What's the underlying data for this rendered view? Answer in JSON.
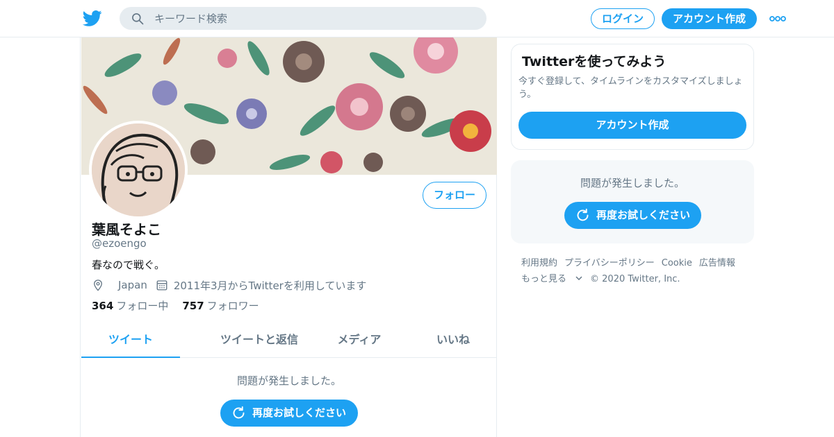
{
  "header": {
    "search_placeholder": "キーワード検索",
    "login_label": "ログイン",
    "signup_label": "アカウント作成",
    "icons": [
      "twitter-bird-icon",
      "search-icon",
      "more-icon"
    ]
  },
  "profile": {
    "follow_label": "フォロー",
    "display_name": "葉風そよこ",
    "handle": "@ezoengo",
    "bio": "春なので戦ぐ。",
    "location": "Japan",
    "joined": "2011年3月からTwitterを利用しています",
    "following_count": "364",
    "following_label": "フォロー中",
    "followers_count": "757",
    "followers_label": "フォロワー"
  },
  "tabs": [
    {
      "label": "ツイート",
      "active": true
    },
    {
      "label": "ツイートと返信",
      "active": false
    },
    {
      "label": "メディア",
      "active": false
    },
    {
      "label": "いいね",
      "active": false
    }
  ],
  "timeline": {
    "error_text": "問題が発生しました。",
    "retry_label": "再度お試しください"
  },
  "sidebar": {
    "promo_title": "Twitterを使ってみよう",
    "promo_text": "今すぐ登録して、タイムラインをカスタマイズしましょう。",
    "promo_button": "アカウント作成",
    "error_text": "問題が発生しました。",
    "retry_label": "再度お試しください"
  },
  "footer": {
    "links": [
      "利用規約",
      "プライバシーポリシー",
      "Cookie",
      "広告情報"
    ],
    "more_label": "もっと見る",
    "copyright": "© 2020 Twitter, Inc."
  },
  "colors": {
    "accent": "#1da1f2",
    "muted": "#657786",
    "border": "#e6ecf0"
  }
}
